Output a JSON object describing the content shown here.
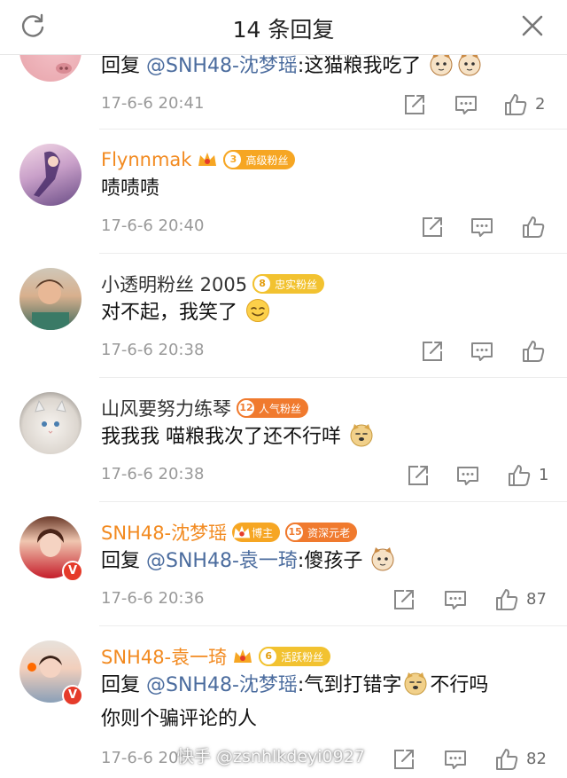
{
  "header": {
    "title": "14 条回复"
  },
  "comments": [
    {
      "name": "",
      "text_prefix": "回复 ",
      "mention": "@SNH48-沈梦瑶",
      "text": ":这猫粮我吃了",
      "time": "17-6-6 20:41",
      "likes": "2"
    },
    {
      "name": "Flynnmak",
      "badge_num": "3",
      "badge_text": "高级粉丝",
      "text": "啧啧啧",
      "time": "17-6-6 20:40",
      "likes": ""
    },
    {
      "name": "小透明粉丝 2005",
      "badge_num": "8",
      "badge_text": "忠实粉丝",
      "text": "对不起，我笑了",
      "time": "17-6-6 20:38",
      "likes": ""
    },
    {
      "name": "山风要努力练琴",
      "badge_num": "12",
      "badge_text": "人气粉丝",
      "text": "我我我  喵粮我次了还不行咩",
      "time": "17-6-6 20:38",
      "likes": "1"
    },
    {
      "name": "SNH48-沈梦瑶",
      "badge1_text": "博主",
      "badge_num": "15",
      "badge_text": "资深元老",
      "text_prefix": "回复 ",
      "mention": "@SNH48-袁一琦",
      "text": ":傻孩子",
      "time": "17-6-6 20:36",
      "likes": "87"
    },
    {
      "name": "SNH48-袁一琦",
      "badge_num": "6",
      "badge_text": "活跃粉丝",
      "text_prefix": "回复 ",
      "mention": "@SNH48-沈梦瑶",
      "text": ":气到打错字",
      "text_suffix": "不行吗",
      "text_line2": "你则个骗评论的人",
      "time": "17-6-6 20:",
      "likes": "82"
    }
  ],
  "watermark": "快手 @zsnhlkdeyi0927",
  "colors": {
    "username": "#f28a20",
    "mention": "#4b6c9e",
    "meta": "#9a9a9a"
  },
  "icons": [
    "refresh-icon",
    "close-icon",
    "share-icon",
    "comment-icon",
    "like-icon",
    "crown-icon",
    "cat-emoji-icon",
    "smile-emoji-icon",
    "doge-emoji-icon"
  ]
}
